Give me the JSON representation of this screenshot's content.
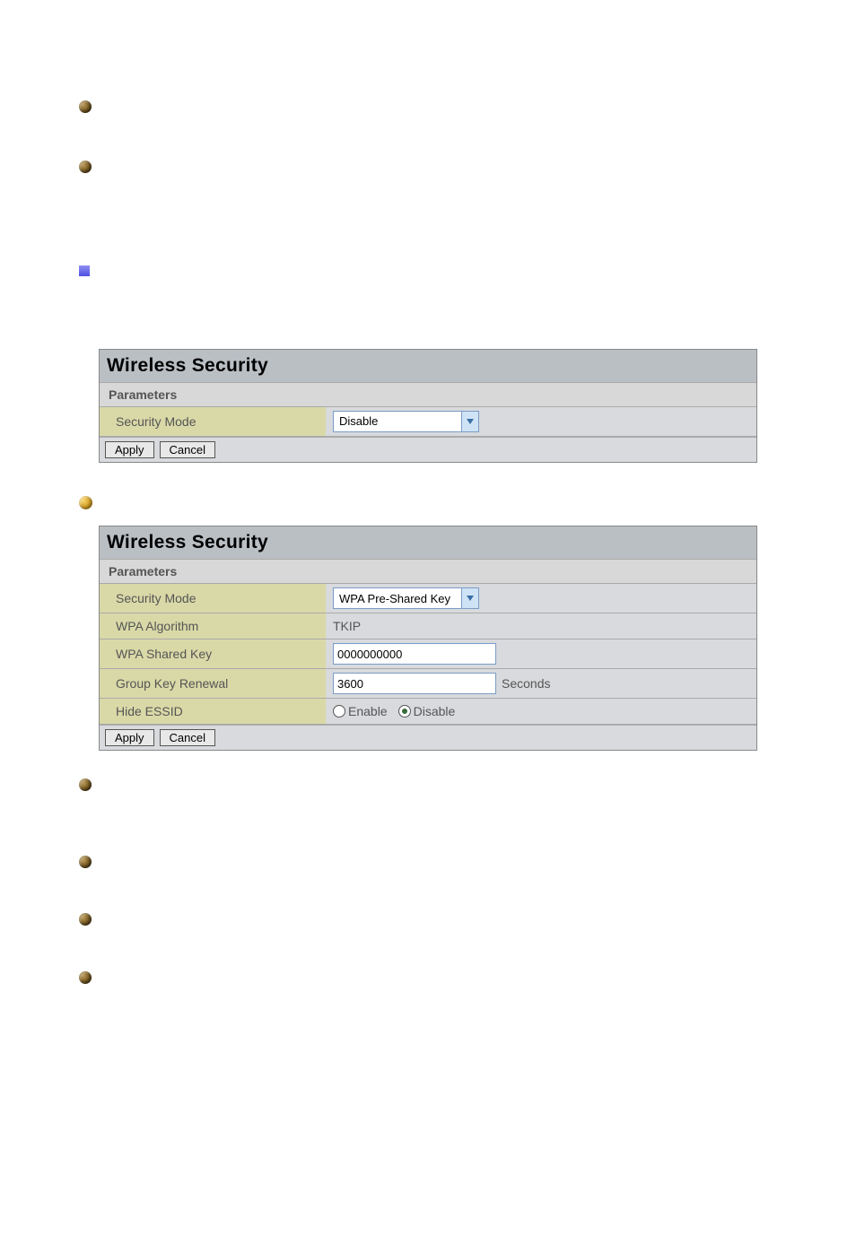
{
  "panel1": {
    "title": "Wireless Security",
    "parameters_label": "Parameters",
    "security_mode_label": "Security Mode",
    "security_mode_value": "Disable",
    "apply_label": "Apply",
    "cancel_label": "Cancel"
  },
  "panel2": {
    "title": "Wireless Security",
    "parameters_label": "Parameters",
    "security_mode_label": "Security Mode",
    "security_mode_value": "WPA Pre-Shared Key",
    "wpa_algorithm_label": "WPA Algorithm",
    "wpa_algorithm_value": "TKIP",
    "wpa_shared_key_label": "WPA Shared Key",
    "wpa_shared_key_value": "0000000000",
    "group_key_renewal_label": "Group Key Renewal",
    "group_key_renewal_value": "3600",
    "group_key_renewal_unit": "Seconds",
    "hide_essid_label": "Hide ESSID",
    "hide_essid_enable_label": "Enable",
    "hide_essid_disable_label": "Disable",
    "hide_essid_selected": "disable",
    "apply_label": "Apply",
    "cancel_label": "Cancel"
  }
}
